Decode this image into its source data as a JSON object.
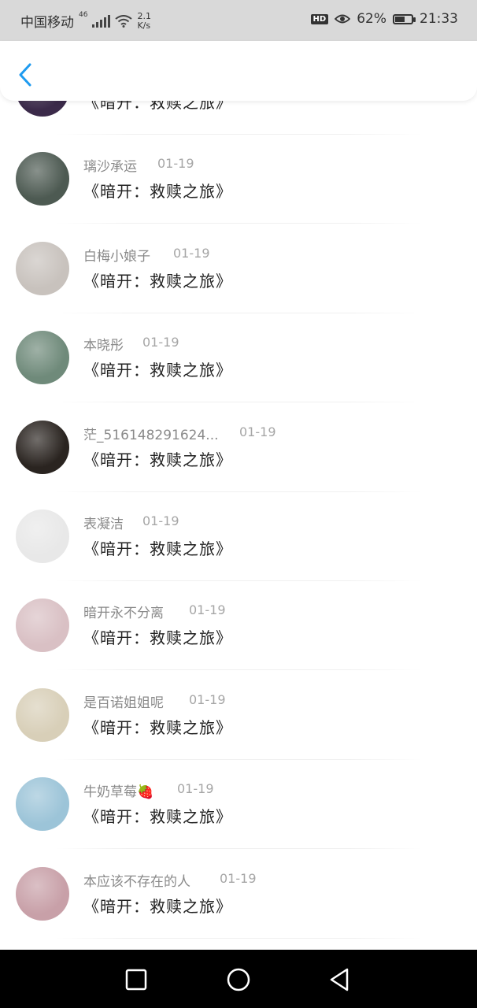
{
  "status_bar": {
    "carrier": "中国移动",
    "network_sup": "46",
    "speed_value": "2.1",
    "speed_unit": "K/s",
    "hd_badge": "HD",
    "battery_percent": "62%",
    "battery_level": 0.62,
    "time": "21:33"
  },
  "list": {
    "items": [
      {
        "username": "",
        "date": "",
        "title": "《暗开：救赎之旅》",
        "avatar_color": "#3b2a4a"
      },
      {
        "username": "璃沙承运",
        "date": "01-19",
        "title": "《暗开：救赎之旅》",
        "avatar_color": "#4d5a52"
      },
      {
        "username": "白梅小娘子",
        "date": "01-19",
        "title": "《暗开：救赎之旅》",
        "avatar_color": "#c8c2bd"
      },
      {
        "username": "本晓彤",
        "date": "01-19",
        "title": "《暗开：救赎之旅》",
        "avatar_color": "#6f8a7a"
      },
      {
        "username": "茫_516148291624...",
        "date": "01-19",
        "title": "《暗开：救赎之旅》",
        "avatar_color": "#2a2420"
      },
      {
        "username": "表凝洁",
        "date": "01-19",
        "title": "《暗开：救赎之旅》",
        "avatar_color": "#e8e8e8"
      },
      {
        "username": "暗开永不分离",
        "date": "01-19",
        "title": "《暗开：救赎之旅》",
        "avatar_color": "#d9c0c4"
      },
      {
        "username": "是百诺姐姐呢",
        "date": "01-19",
        "title": "《暗开：救赎之旅》",
        "avatar_color": "#d8cfb8"
      },
      {
        "username": "牛奶草莓🍓",
        "date": "01-19",
        "title": "《暗开：救赎之旅》",
        "avatar_color": "#9cc4d8"
      },
      {
        "username": "本应该不存在的人",
        "date": "01-19",
        "title": "《暗开：救赎之旅》",
        "avatar_color": "#c8a0a8"
      }
    ]
  },
  "colors": {
    "accent_blue": "#1e9bf0",
    "username_gray": "#8a8a8a",
    "title_dark": "#222222"
  }
}
